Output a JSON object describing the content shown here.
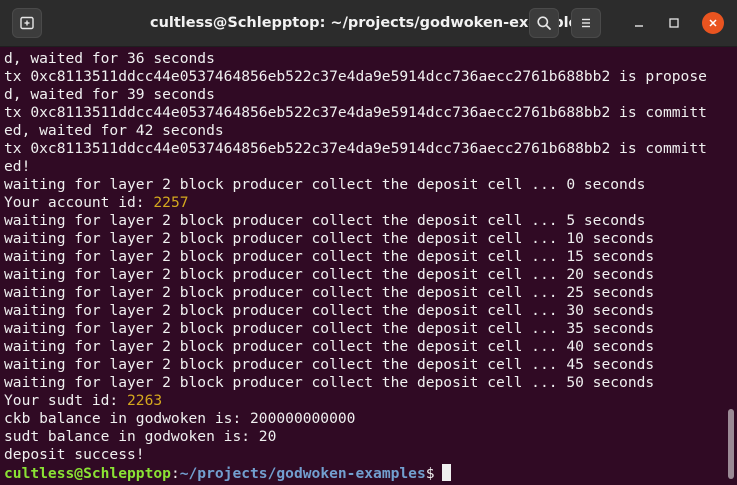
{
  "window": {
    "title": "cultless@Schlepptop: ~/projects/godwoken-examples",
    "icons": {
      "new_tab": "new-tab-icon",
      "search": "search-icon",
      "menu": "hamburger-menu-icon",
      "minimize": "minimize-icon",
      "maximize": "maximize-icon",
      "close": "close-icon"
    },
    "accent_close": "#e95420",
    "terminal_bg": "#300a24"
  },
  "terminal": {
    "lines": [
      {
        "text": "d, waited for 36 seconds"
      },
      {
        "text": "tx 0xc8113511ddcc44e0537464856eb522c37e4da9e5914dcc736aecc2761b688bb2 is propose"
      },
      {
        "text": "d, waited for 39 seconds"
      },
      {
        "text": "tx 0xc8113511ddcc44e0537464856eb522c37e4da9e5914dcc736aecc2761b688bb2 is committ"
      },
      {
        "text": "ed, waited for 42 seconds"
      },
      {
        "text": "tx 0xc8113511ddcc44e0537464856eb522c37e4da9e5914dcc736aecc2761b688bb2 is committ"
      },
      {
        "text": "ed!"
      },
      {
        "text": "waiting for layer 2 block producer collect the deposit cell ... 0 seconds"
      },
      {
        "text": "Your account id: ",
        "num": "2257"
      },
      {
        "text": "waiting for layer 2 block producer collect the deposit cell ... 5 seconds"
      },
      {
        "text": "waiting for layer 2 block producer collect the deposit cell ... 10 seconds"
      },
      {
        "text": "waiting for layer 2 block producer collect the deposit cell ... 15 seconds"
      },
      {
        "text": "waiting for layer 2 block producer collect the deposit cell ... 20 seconds"
      },
      {
        "text": "waiting for layer 2 block producer collect the deposit cell ... 25 seconds"
      },
      {
        "text": "waiting for layer 2 block producer collect the deposit cell ... 30 seconds"
      },
      {
        "text": "waiting for layer 2 block producer collect the deposit cell ... 35 seconds"
      },
      {
        "text": "waiting for layer 2 block producer collect the deposit cell ... 40 seconds"
      },
      {
        "text": "waiting for layer 2 block producer collect the deposit cell ... 45 seconds"
      },
      {
        "text": "waiting for layer 2 block producer collect the deposit cell ... 50 seconds"
      },
      {
        "text": "Your sudt id: ",
        "num": "2263"
      },
      {
        "text": "ckb balance in godwoken is: 200000000000"
      },
      {
        "text": "sudt balance in godwoken is: 20"
      },
      {
        "text": "deposit success!"
      }
    ],
    "prompt": {
      "user_host": "cultless@Schlepptop",
      "separator": ":",
      "path": "~/projects/godwoken-examples",
      "symbol": "$"
    }
  }
}
